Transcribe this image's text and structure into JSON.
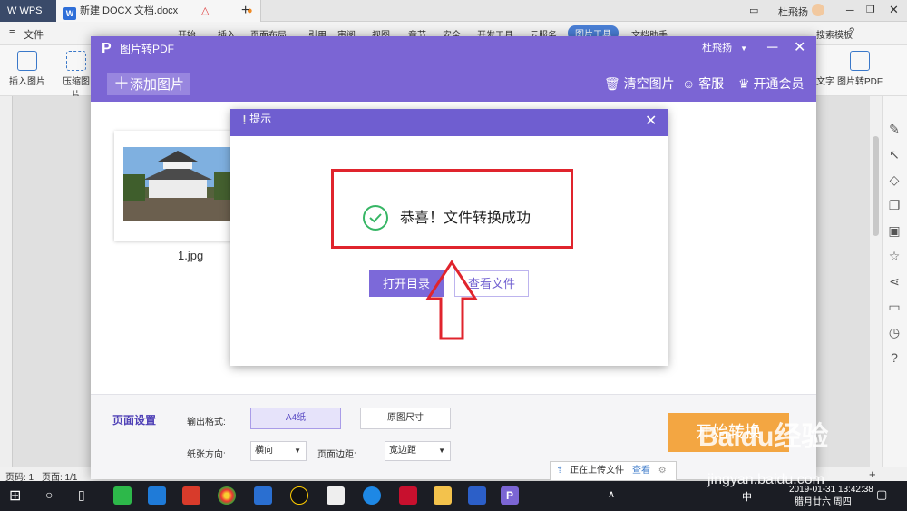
{
  "wps": {
    "app_tab": "WPS",
    "doc_tab": "新建 DOCX 文档.docx",
    "new_tab": "+",
    "user": "杜飛扬"
  },
  "menubar": {
    "file_menu": "文件",
    "items": [
      "开始",
      "插入",
      "页面布局",
      "引用",
      "审阅",
      "视图",
      "章节",
      "安全",
      "开发工具",
      "云服务",
      "图片工具",
      "文档助手"
    ],
    "search": "查找命令",
    "template_search": "搜索模板"
  },
  "ribbon": {
    "insert_pic": "插入图片",
    "compress_pic": "压缩图片",
    "to_text": "文字",
    "pic_to_pdf": "图片转PDF"
  },
  "statusbar": {
    "page_code": "页码: 1",
    "pages": "页面: 1/1"
  },
  "pdf_window": {
    "title": "图片转PDF",
    "user": "杜飛扬",
    "add_images": "添加图片",
    "clear_images": "清空图片",
    "service": "客服",
    "membership": "开通会员",
    "thumbnail_name": "1.jpg",
    "page_setup": "页面设置",
    "output_format_label": "输出格式:",
    "format_a4": "A4纸",
    "format_original": "原图尺寸",
    "orientation_label": "纸张方向:",
    "orientation_value": "横向",
    "margin_label": "页面边距:",
    "margin_value": "宽边距",
    "start_button": "开始转换"
  },
  "modal": {
    "title": "提示",
    "message": "恭喜！文件转换成功",
    "open_dir": "打开目录",
    "view_file": "查看文件"
  },
  "upload_toast": {
    "text": "正在上传文件",
    "link": "查看"
  },
  "taskbar": {
    "ime": "中",
    "time": "13:42:38",
    "date": "2019-01-31",
    "lunar": "腊月廿六 周四"
  },
  "watermark": {
    "brand": "Baidu经验",
    "url": "jingyan.baidu.com"
  },
  "colors": {
    "pdf_purple": "#7b65d4",
    "modal_header": "#6f5ed0",
    "success_green": "#37b665",
    "highlight_red": "#e0242d",
    "start_orange": "#f3a642"
  }
}
